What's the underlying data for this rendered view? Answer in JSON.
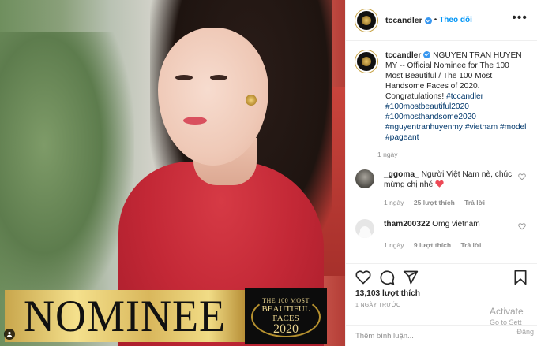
{
  "photo": {
    "banner_text": "NOMINEE",
    "badge": {
      "line1": "THE 100 MOST",
      "line2": "BEAUTIFUL",
      "line3": "FACES",
      "year": "2020"
    }
  },
  "header": {
    "username": "tccandler",
    "separator": "•",
    "follow_label": "Theo dõi",
    "more_label": "•••"
  },
  "caption": {
    "username": "tccandler",
    "text": "NGUYEN TRAN HUYEN MY -- Official Nominee for The 100 Most Beautiful / The 100 Most Handsome Faces of 2020. Congratulations!",
    "hashtags": [
      "#tccandler",
      "#100mostbeautiful2020",
      "#100mosthandsome2020",
      "#nguyentranhuyenmy",
      "#vietnam",
      "#model",
      "#pageant"
    ],
    "time": "1 ngày"
  },
  "comments": [
    {
      "username": "_ggoma_",
      "text": "Người Việt Nam nè, chúc mừng chị nhé",
      "time": "1 ngày",
      "likes": "25 lượt thích",
      "reply": "Trả lời"
    },
    {
      "username": "tham200322",
      "text": "Omg vietnam",
      "time": "1 ngày",
      "likes": "9 lượt thích",
      "reply": "Trả lời"
    }
  ],
  "actions": {
    "likes": "13,103 lượt thích",
    "posted": "1 NGÀY TRƯỚC",
    "add_comment_placeholder": "Thêm bình luận..."
  },
  "watermark": {
    "line1": "Activate",
    "line2": "Go to Sett",
    "line3": "Đăng"
  },
  "colors": {
    "accent": "#0095f6",
    "hashtag": "#00376b",
    "heart": "#ed4956",
    "text": "#262626",
    "muted": "#8e8e8e"
  }
}
